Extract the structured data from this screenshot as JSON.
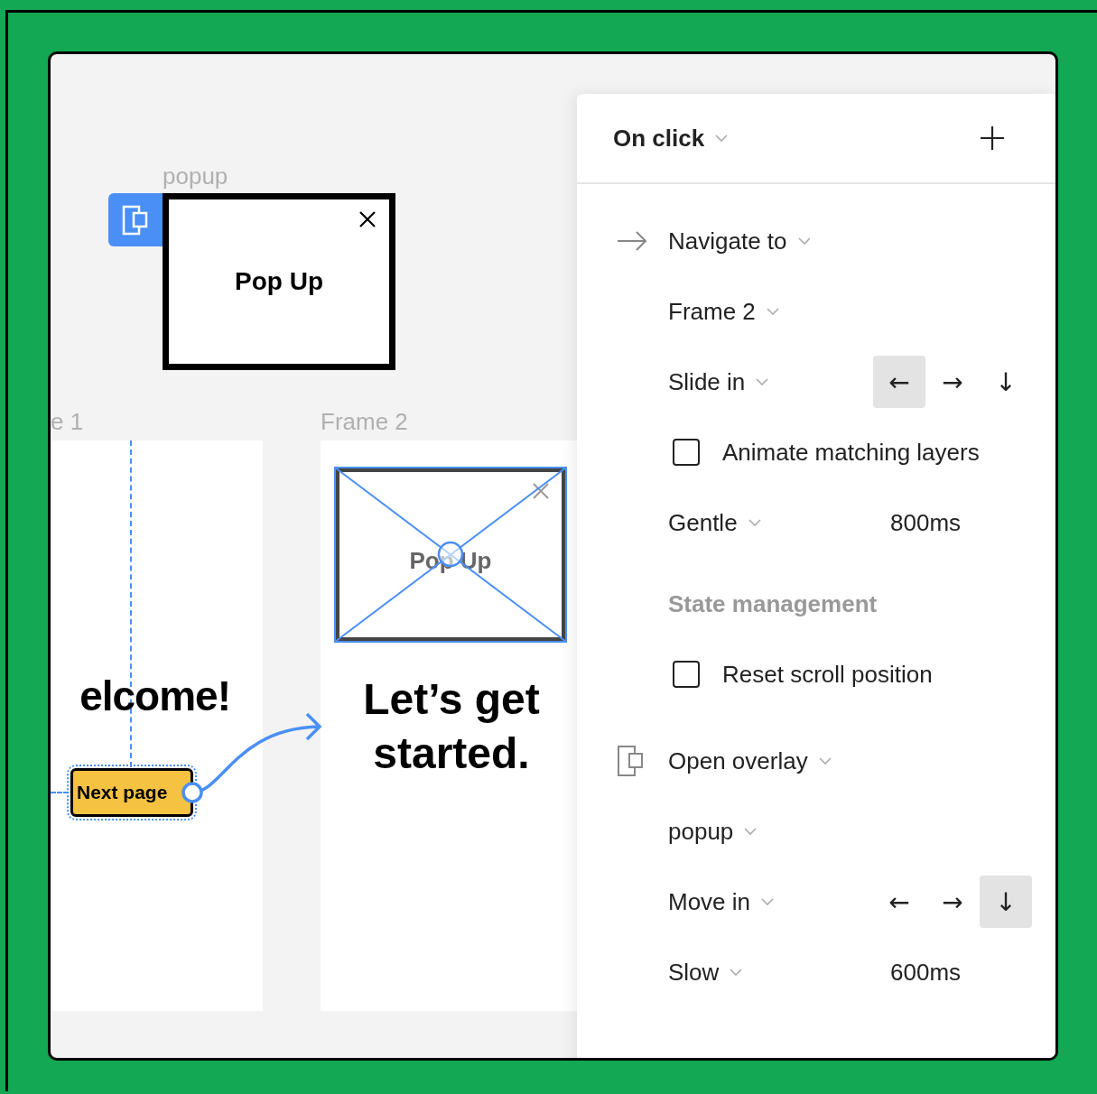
{
  "canvas": {
    "overlay_frame": {
      "label": "popup",
      "title": "Pop Up"
    },
    "frames": [
      {
        "kind": "start",
        "label": "e 1",
        "heading": "elcome!",
        "button": "Next page"
      },
      {
        "kind": "target",
        "label": "Frame 2",
        "heading": "Let’s get started.",
        "placeholder_title": "Pop Up"
      }
    ]
  },
  "panel": {
    "trigger": "On click",
    "rows": [
      {
        "kind": "navigate-action",
        "label": "Navigate to"
      },
      {
        "kind": "select",
        "label": "Frame 2"
      },
      {
        "kind": "transition",
        "label": "Slide in",
        "directions": [
          {
            "symbol": "←",
            "selected": true
          },
          {
            "symbol": "→",
            "selected": false
          },
          {
            "symbol": "↓",
            "selected": false
          }
        ]
      },
      {
        "kind": "checkbox",
        "label": "Animate matching layers",
        "checked": false
      },
      {
        "kind": "easing",
        "label": "Gentle",
        "duration": "800ms"
      },
      {
        "kind": "section",
        "label": "State management"
      },
      {
        "kind": "checkbox",
        "label": "Reset scroll position",
        "checked": false
      },
      {
        "kind": "overlay-action",
        "label": "Open overlay"
      },
      {
        "kind": "select",
        "label": "popup"
      },
      {
        "kind": "transition",
        "label": "Move in",
        "directions": [
          {
            "symbol": "←",
            "selected": false
          },
          {
            "symbol": "→",
            "selected": false
          },
          {
            "symbol": "↓",
            "selected": true
          }
        ]
      },
      {
        "kind": "easing",
        "label": "Slow",
        "duration": "600ms"
      }
    ]
  }
}
